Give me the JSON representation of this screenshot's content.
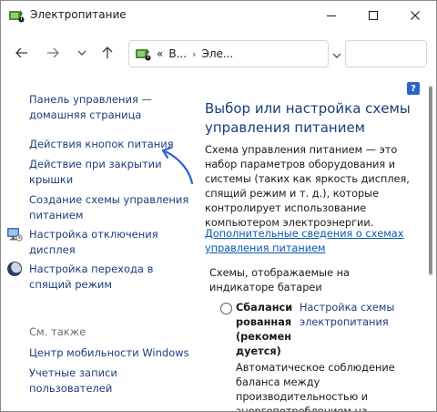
{
  "window": {
    "title": "Электропитание"
  },
  "address": {
    "seg1": "В...",
    "seg2": "Эле...",
    "prefix": "«",
    "sep": "›"
  },
  "left": {
    "home": "Панель управления —\nдомашняя страница",
    "power_buttons": "Действия кнопок питания",
    "lid_close": "Действие при закрытии\nкрышки",
    "create_plan": "Создание схемы управления\nпитанием",
    "display_off": "Настройка отключения\nдисплея",
    "sleep": "Настройка перехода в\nспящий режим",
    "see_also": "См. также",
    "mobility": "Центр мобильности Windows",
    "accounts": "Учетные записи\nпользователей"
  },
  "right": {
    "heading": "Выбор или настройка схемы\nуправления питанием",
    "description": "Схема управления питанием — это набор параметров оборудования и системы (таких как яркость дисплея, спящий режим и т. д.), которые контролирует использование компьютером электроэнергии.",
    "more_info": "Дополнительные сведения о схемах управления питанием",
    "plans_label": "Схемы, отображаемые на индикаторе батареи",
    "plan_name": "Сбаланси\nрованная\n(рекомен\nдуется)",
    "plan_settings": "Настройка схемы\nэлектропитания",
    "plan_desc": "Автоматическое соблюдение баланса между производительностью и энергопотреблением на"
  },
  "help": {
    "label": "?"
  },
  "colors": {
    "link": "#1a3e7a",
    "underline_link": "#0a59b0",
    "annotation": "#2a63d4"
  }
}
